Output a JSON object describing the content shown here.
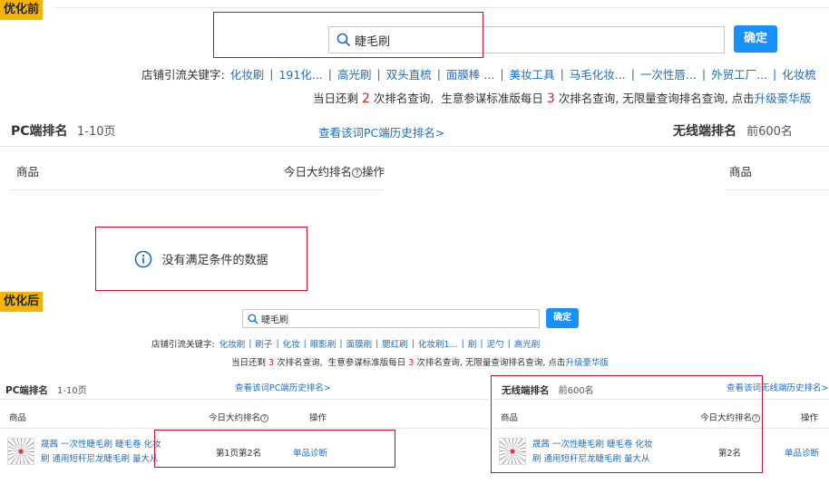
{
  "before": {
    "tag": "优化前",
    "search_value": "睫毛刷",
    "confirm": "确定",
    "kw_label": "店铺引流关键字:",
    "keywords": [
      "化妆刷",
      "191化...",
      "高光刷",
      "双头直梳",
      "面膜棒 ...",
      "美妆工具",
      "马毛化妆...",
      "一次性唇...",
      "外贸工厂...",
      "化妆梳"
    ],
    "quota": {
      "p1": "当日还剩",
      "n1": "2",
      "p2": "次排名查询,",
      "p3": "生意参谋标准版每日",
      "n2": "3",
      "p4": "次排名查询, 无限量查询排名查询,",
      "p5": "点击",
      "upgrade": "升级豪华版"
    },
    "pc_title": "PC端排名",
    "pc_pages": "1-10页",
    "history_link": "查看该词PC端历史排名>",
    "wl_title": "无线端排名",
    "wl_top": "前600名",
    "col_product": "商品",
    "col_rank": "今日大约排名",
    "col_action": "操作",
    "col_product_right": "商品",
    "empty_msg": "没有满足条件的数据"
  },
  "after": {
    "tag": "优化后",
    "search_value": "睫毛刷",
    "confirm": "确定",
    "kw_label": "店铺引流关键字:",
    "keywords": [
      "化妆刷",
      "刷子",
      "化妆",
      "眼影刷",
      "面膜刷",
      "腮红刷",
      "化妆刷1...",
      "刷",
      "泥勺",
      "高光刷"
    ],
    "quota": {
      "p1": "当日还剩",
      "n1": "3",
      "p2": "次排名查询,",
      "p3": "生意参谋标准版每日",
      "n2": "3",
      "p4": "次排名查询, 无限量查询排名查询,",
      "p5": "点击",
      "upgrade": "升级豪华版"
    },
    "pc_title": "PC端排名",
    "pc_pages": "1-10页",
    "history_link_pc": "查看该词PC端历史排名>",
    "wl_title": "无线端排名",
    "wl_top": "前600名",
    "history_link_wl": "查看该词无线端历史排名>",
    "col_product": "商品",
    "col_rank": "今日大约排名",
    "col_action": "操作",
    "pc_row": {
      "title_line1": "晟茜 一次性睫毛刷 睫毛卷 化妆",
      "title_line2": "刷 通用短杆尼龙睫毛刷 量大从",
      "rank": "第1页第2名",
      "action": "单品诊断"
    },
    "wl_row": {
      "title_line1": "晟茜 一次性睫毛刷 睫毛卷 化妆",
      "title_line2": "刷 通用短杆尼龙睫毛刷 量大从",
      "rank": "第2名",
      "action": "单品诊断"
    }
  }
}
